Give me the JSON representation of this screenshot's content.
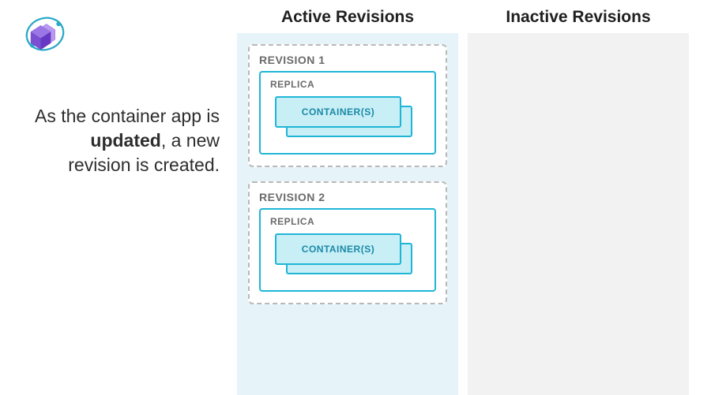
{
  "caption_parts": {
    "pre": "As the container app is ",
    "bold": "updated",
    "post": ", a new revision is created."
  },
  "columns": {
    "active": {
      "title": "Active Revisions"
    },
    "inactive": {
      "title": "Inactive Revisions"
    }
  },
  "revisions_active": [
    {
      "label": "REVISION 1",
      "replica_label": "REPLICA",
      "container_label": "CONTAINER(S)"
    },
    {
      "label": "REVISION 2",
      "replica_label": "REPLICA",
      "container_label": "CONTAINER(S)"
    }
  ],
  "revisions_inactive": [],
  "colors": {
    "active_bg": "#e6f4fa",
    "inactive_bg": "#f2f2f2",
    "teal_border": "#1fb6d6",
    "teal_fill": "#c8eef6",
    "dash_border": "#b8b8b8",
    "purple": "#7b4fd1"
  }
}
